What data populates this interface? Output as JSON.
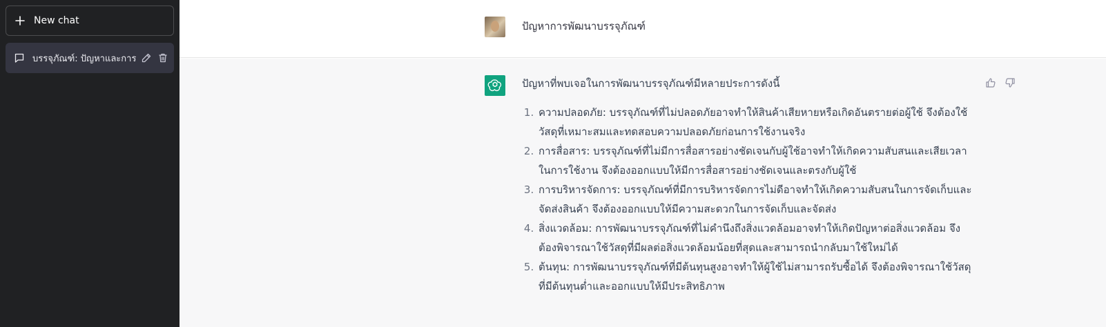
{
  "sidebar": {
    "new_chat_label": "New chat",
    "conversations": [
      {
        "title": "บรรจุภัณฑ์: ปัญหาและการ"
      }
    ]
  },
  "chat": {
    "user_message": "ปัญหาการพัฒนาบรรจุภัณฑ์",
    "assistant_intro": "ปัญหาที่พบเจอในการพัฒนาบรรจุภัณฑ์มีหลายประการดังนี้",
    "assistant_items": [
      "ความปลอดภัย: บรรจุภัณฑ์ที่ไม่ปลอดภัยอาจทำให้สินค้าเสียหายหรือเกิดอันตรายต่อผู้ใช้ จึงต้องใช้วัสดุที่เหมาะสมและทดสอบความปลอดภัยก่อนการใช้งานจริง",
      "การสื่อสาร: บรรจุภัณฑ์ที่ไม่มีการสื่อสารอย่างชัดเจนกับผู้ใช้อาจทำให้เกิดความสับสนและเสียเวลาในการใช้งาน จึงต้องออกแบบให้มีการสื่อสารอย่างชัดเจนและตรงกับผู้ใช้",
      "การบริหารจัดการ: บรรจุภัณฑ์ที่มีการบริหารจัดการไม่ดีอาจทำให้เกิดความสับสนในการจัดเก็บและจัดส่งสินค้า จึงต้องออกแบบให้มีความสะดวกในการจัดเก็บและจัดส่ง",
      "สิ่งแวดล้อม: การพัฒนาบรรจุภัณฑ์ที่ไม่คำนึงถึงสิ่งแวดล้อมอาจทำให้เกิดปัญหาต่อสิ่งแวดล้อม จึงต้องพิจารณาใช้วัสดุที่มีผลต่อสิ่งแวดล้อมน้อยที่สุดและสามารถนำกลับมาใช้ใหม่ได้",
      "ต้นทุน: การพัฒนาบรรจุภัณฑ์ที่มีต้นทุนสูงอาจทำให้ผู้ใช้ไม่สามารถรับซื้อได้ จึงต้องพิจารณาใช้วัสดุที่มีต้นทุนต่ำและออกแบบให้มีประสิทธิภาพ"
    ]
  },
  "icons": {
    "new_chat": "plus-icon",
    "conversation": "chat-bubble-icon",
    "edit": "pencil-icon",
    "delete": "trash-icon",
    "assistant_avatar": "openai-logo-icon",
    "thumbs_up": "thumbs-up-icon",
    "thumbs_down": "thumbs-down-icon"
  },
  "colors": {
    "sidebar_bg": "#202123",
    "selected_conv_bg": "#343541",
    "assistant_bg": "#f7f7f8",
    "assistant_avatar_bg": "#10a37f",
    "text": "#374151"
  }
}
